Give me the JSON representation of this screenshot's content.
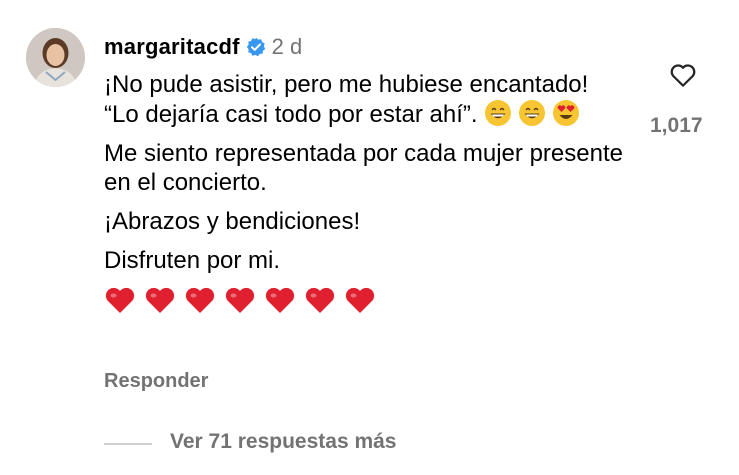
{
  "comment": {
    "username": "margaritacdf",
    "time": "2 d",
    "paragraphs": [
      "¡No pude asistir, pero me hubiese encantado! “Lo dejaría casi todo por estar ahí”.",
      "Me siento representada por cada mujer presente en el concierto.",
      "¡Abrazos y bendiciones!",
      "Disfruten por mi."
    ],
    "reply_label": "Responder",
    "like_count": "1,017",
    "view_replies": "Ver 71 respuestas más"
  },
  "icons": {
    "avatar": "avatar",
    "verified": "verified-badge-icon",
    "like": "heart-outline-icon",
    "emoji_grin": "grinning-face-icon",
    "emoji_heart_eyes": "heart-eyes-face-icon",
    "heart": "red-heart-icon"
  },
  "colors": {
    "verified_blue": "#3897f0",
    "muted_text": "#737373",
    "heart_red": "#e0202e"
  }
}
